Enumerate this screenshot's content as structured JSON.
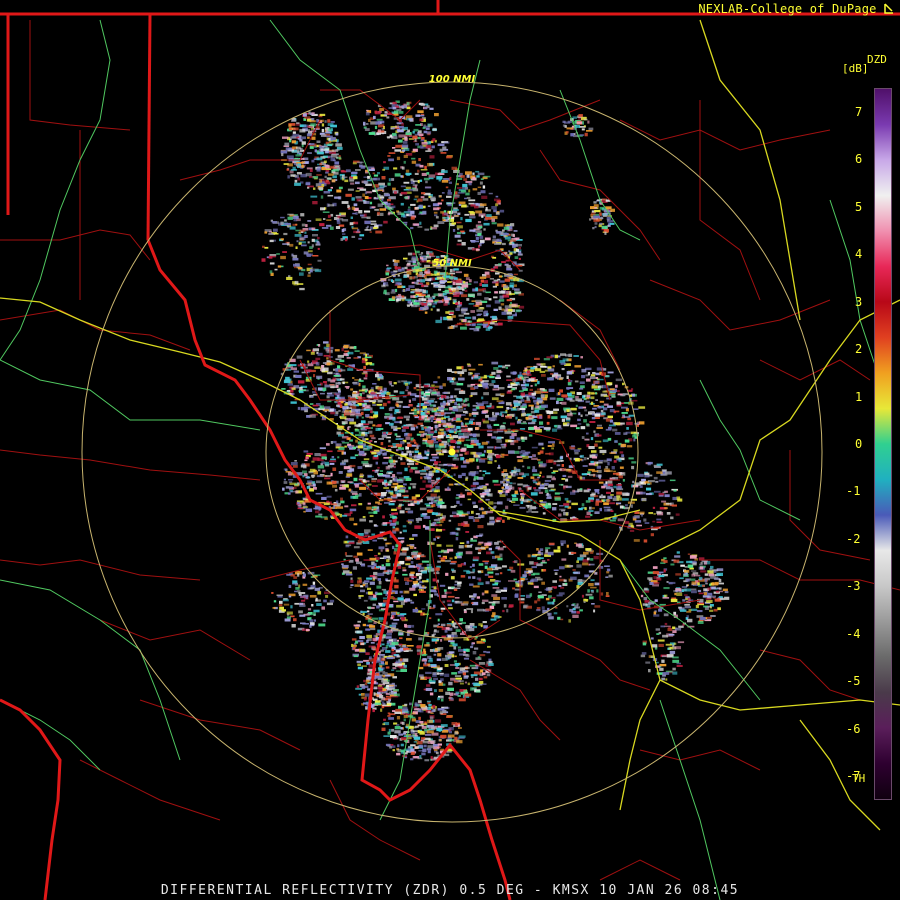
{
  "credit": "NEXLAB-College of DuPage",
  "credit_icon": "cursor-arrow-icon",
  "product_title": "DIFFERENTIAL REFLECTIVITY (ZDR) 0.5 DEG - KMSX 10 JAN 26 08:45",
  "range_rings": [
    {
      "label": "50 NMI",
      "distance_nmi": 50
    },
    {
      "label": "100 NMI",
      "distance_nmi": 100
    }
  ],
  "legend": {
    "unit": "[dB]",
    "code": "DZD",
    "ticks": [
      "7",
      "6",
      "5",
      "4",
      "3",
      "2",
      "1",
      "0",
      "-1",
      "-2",
      "-3",
      "-4",
      "-5",
      "-6",
      "-7"
    ],
    "threshold_label": "TH",
    "range_db": [
      -7.5,
      7.5
    ],
    "color_stops": [
      "#100010",
      "#2e0030",
      "#5a1e5a",
      "#4a3a4a",
      "#6a6a6a",
      "#9a9a9a",
      "#c8c8c8",
      "#e8e8e8",
      "#4a5ab8",
      "#20b0c0",
      "#30d090",
      "#e8e838",
      "#f0a020",
      "#e04020",
      "#b80818",
      "#e82858",
      "#f090b0",
      "#f0f0f0",
      "#c8a8e8",
      "#7a3ab0",
      "#50106a"
    ]
  },
  "colors": {
    "state_border": "#e01818",
    "county_line": "#a01010",
    "highway": "#d8d820",
    "river": "#50c860",
    "range_ring": "#c8b46e",
    "label": "#ffff33"
  }
}
